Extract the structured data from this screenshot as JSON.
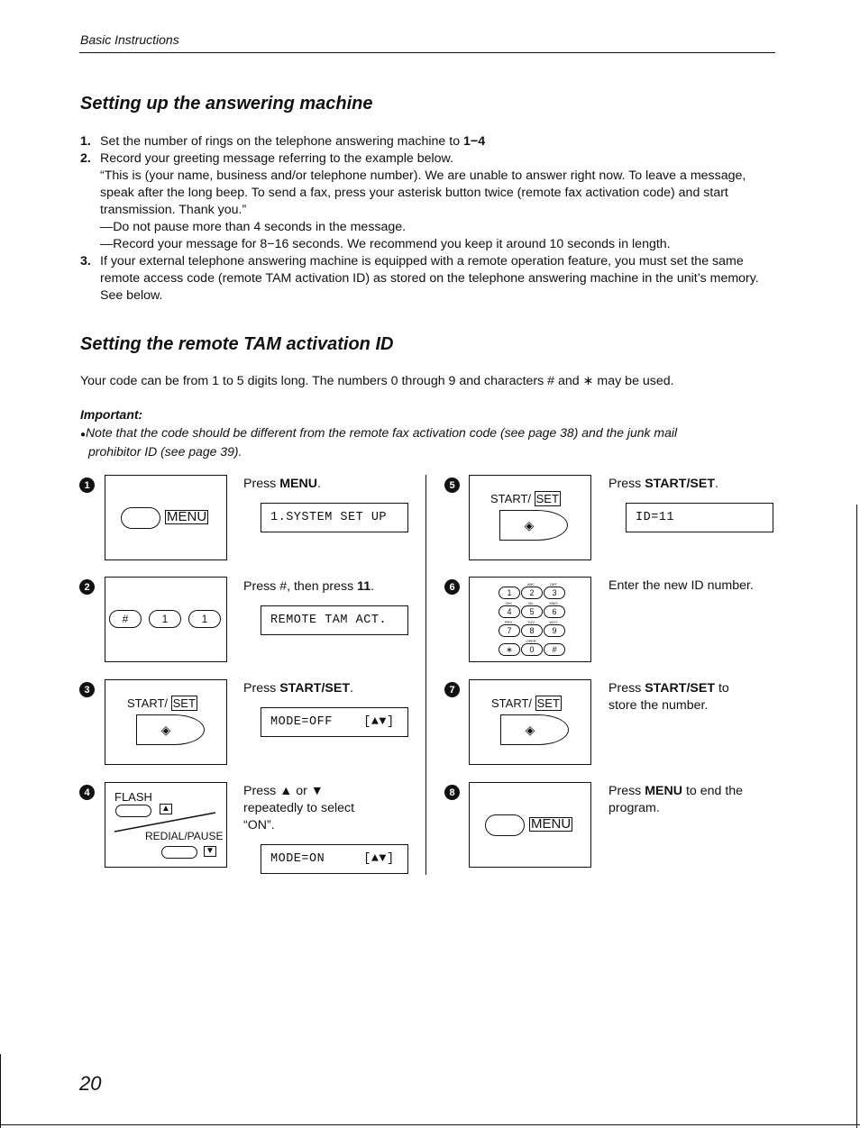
{
  "header": {
    "section_label": "Basic Instructions"
  },
  "section1": {
    "title": "Setting up the answering machine",
    "items": [
      {
        "num": "1.",
        "text": "Set the number of rings on the telephone answering machine to ",
        "bold_tail": "1−4"
      },
      {
        "num": "2.",
        "text": "Record your greeting message referring to the example below.",
        "sub": [
          "“This is (your name, business and/or telephone number). We are unable to answer right now. To leave a message, speak after the long beep. To send a fax, press your asterisk button twice (remote fax activation code) and start transmission. Thank you.”",
          "—Do not pause more than 4 seconds in the message.",
          "—Record your message for 8−16 seconds. We recommend you keep it around 10 seconds in length."
        ]
      },
      {
        "num": "3.",
        "text": "If your external telephone answering machine is equipped with a remote operation feature, you must set the same remote access code (remote TAM activation ID) as stored on the telephone answering machine in the unit’s memory. See below."
      }
    ]
  },
  "section2": {
    "title": "Setting the remote TAM activation ID",
    "intro": "Your code can be from 1 to 5 digits long. The numbers 0 through 9 and characters # and ∗ may be used.",
    "important_label": "Important:",
    "note_bullet": "●",
    "note_text": "Note that the code should be different from the remote fax activation code (see page 38) and the junk mail",
    "note_text_cont": "prohibitor ID (see page 39)."
  },
  "steps": [
    {
      "num": "1",
      "instr_pre": "Press ",
      "instr_bold": "MENU",
      "instr_post": ".",
      "lcd": "1.SYSTEM SET UP",
      "panel": {
        "button_label": "MENU"
      }
    },
    {
      "num": "2",
      "instr_pre": "Press #, then press ",
      "instr_bold": "11",
      "instr_post": ".",
      "lcd": "REMOTE TAM ACT.",
      "panel": {
        "keys": [
          "#",
          "1",
          "1"
        ]
      }
    },
    {
      "num": "3",
      "instr_pre": "Press ",
      "instr_bold": "START/SET",
      "instr_post": ".",
      "lcd": "MODE=OFF    [▲▼]",
      "panel": {
        "label_pre": "START/ ",
        "label_box": "SET",
        "glyph": "◈"
      }
    },
    {
      "num": "4",
      "instr_pre": "Press ▲ or ▼",
      "instr_line2": "repeatedly to select",
      "instr_line3": "“ON”.",
      "lcd": "MODE=ON     [▲▼]",
      "panel": {
        "flash_label": "FLASH",
        "redial_label": "REDIAL/PAUSE",
        "up": "▲",
        "down": "▼"
      }
    },
    {
      "num": "5",
      "instr_pre": "Press ",
      "instr_bold": "START/SET",
      "instr_post": ".",
      "lcd": "ID=11",
      "panel": {
        "label_pre": "START/ ",
        "label_box": "SET",
        "glyph": "◈"
      }
    },
    {
      "num": "6",
      "instr_pre": "Enter the new ID number.",
      "panel": {
        "keys": [
          "1",
          "2",
          "3",
          "4",
          "5",
          "6",
          "7",
          "8",
          "9",
          "∗",
          "0",
          "#"
        ],
        "subs": [
          "",
          "ABC",
          "DEF",
          "GHI",
          "JKL",
          "MNO",
          "PRS",
          "TUV",
          "WXY",
          "",
          "OPER",
          ""
        ]
      }
    },
    {
      "num": "7",
      "instr_pre": "Press ",
      "instr_bold": "START/SET",
      "instr_post": " to",
      "instr_line2": "store the number.",
      "panel": {
        "label_pre": "START/ ",
        "label_box": "SET",
        "glyph": "◈"
      }
    },
    {
      "num": "8",
      "instr_pre": "Press ",
      "instr_bold": "MENU",
      "instr_post": " to end the",
      "instr_line2": "program.",
      "panel": {
        "button_label": "MENU"
      }
    }
  ],
  "footer": {
    "page_number": "20"
  }
}
